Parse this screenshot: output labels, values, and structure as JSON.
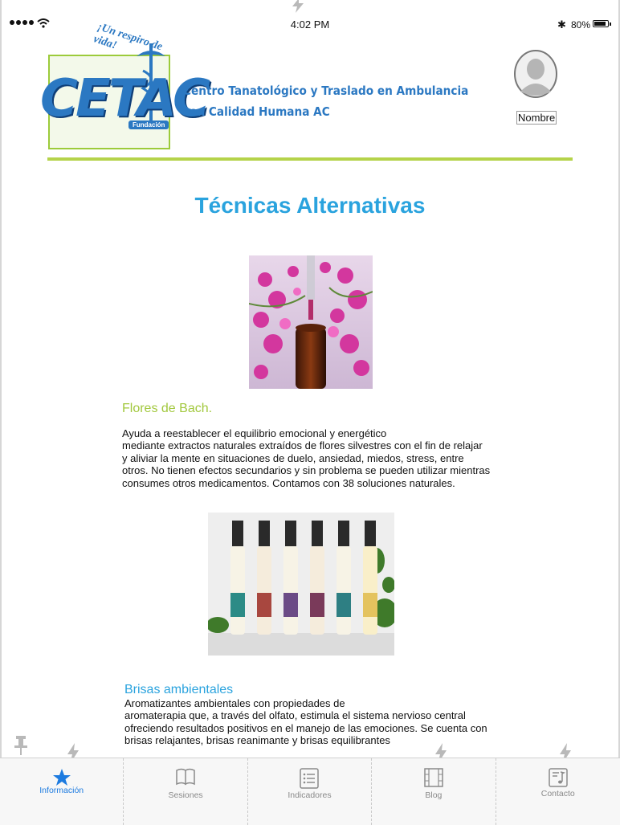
{
  "status_bar": {
    "time": "4:02 PM",
    "battery": "80%",
    "battery_level": 0.8
  },
  "header": {
    "logo_text": "CETAC",
    "logo_tagline": "¡Un respiro de vida!",
    "logo_badge": "Fundación",
    "org_name_line1": "Centro Tanatológico y Traslado en Ambulancia",
    "org_name_line2": "con Calidad Humana AC",
    "user_label": "Nombre"
  },
  "page": {
    "title": "Técnicas Alternativas",
    "sections": [
      {
        "title": "Flores de Bach.",
        "body": "Ayuda a reestablecer el equilibrio emocional y energético\nmediante extractos naturales extraídos de flores silvestres con el fin de relajar\ny aliviar la mente en situaciones de duelo, ansiedad, miedos, stress, entre\notros. No tienen efectos secundarios y sin problema se pueden utilizar mientras\nconsumes otros medicamentos. Contamos con 38 soluciones naturales."
      },
      {
        "title": "Brisas ambientales",
        "body": "Aromatizantes   ambientales   con   propiedades   de\naromaterapia que, a través del olfato, estimula el sistema nervioso central\nofreciendo resultados positivos en el manejo de las emociones. Se cuenta con\nbrisas relajantes, brisas reanimante y brisas equilibrantes"
      }
    ]
  },
  "tabs": [
    {
      "label": "Información",
      "icon": "star-icon",
      "active": true
    },
    {
      "label": "Sesiones",
      "icon": "book-icon",
      "active": false
    },
    {
      "label": "Indicadores",
      "icon": "list-icon",
      "active": false
    },
    {
      "label": "Blog",
      "icon": "film-icon",
      "active": false
    },
    {
      "label": "Contacto",
      "icon": "music-note-icon",
      "active": false
    }
  ],
  "colors": {
    "accent_blue": "#2aa3de",
    "logo_blue": "#2b78c2",
    "accent_green": "#a2c83e",
    "tab_active": "#1d7be0",
    "tab_inactive": "#8a8a8a"
  }
}
